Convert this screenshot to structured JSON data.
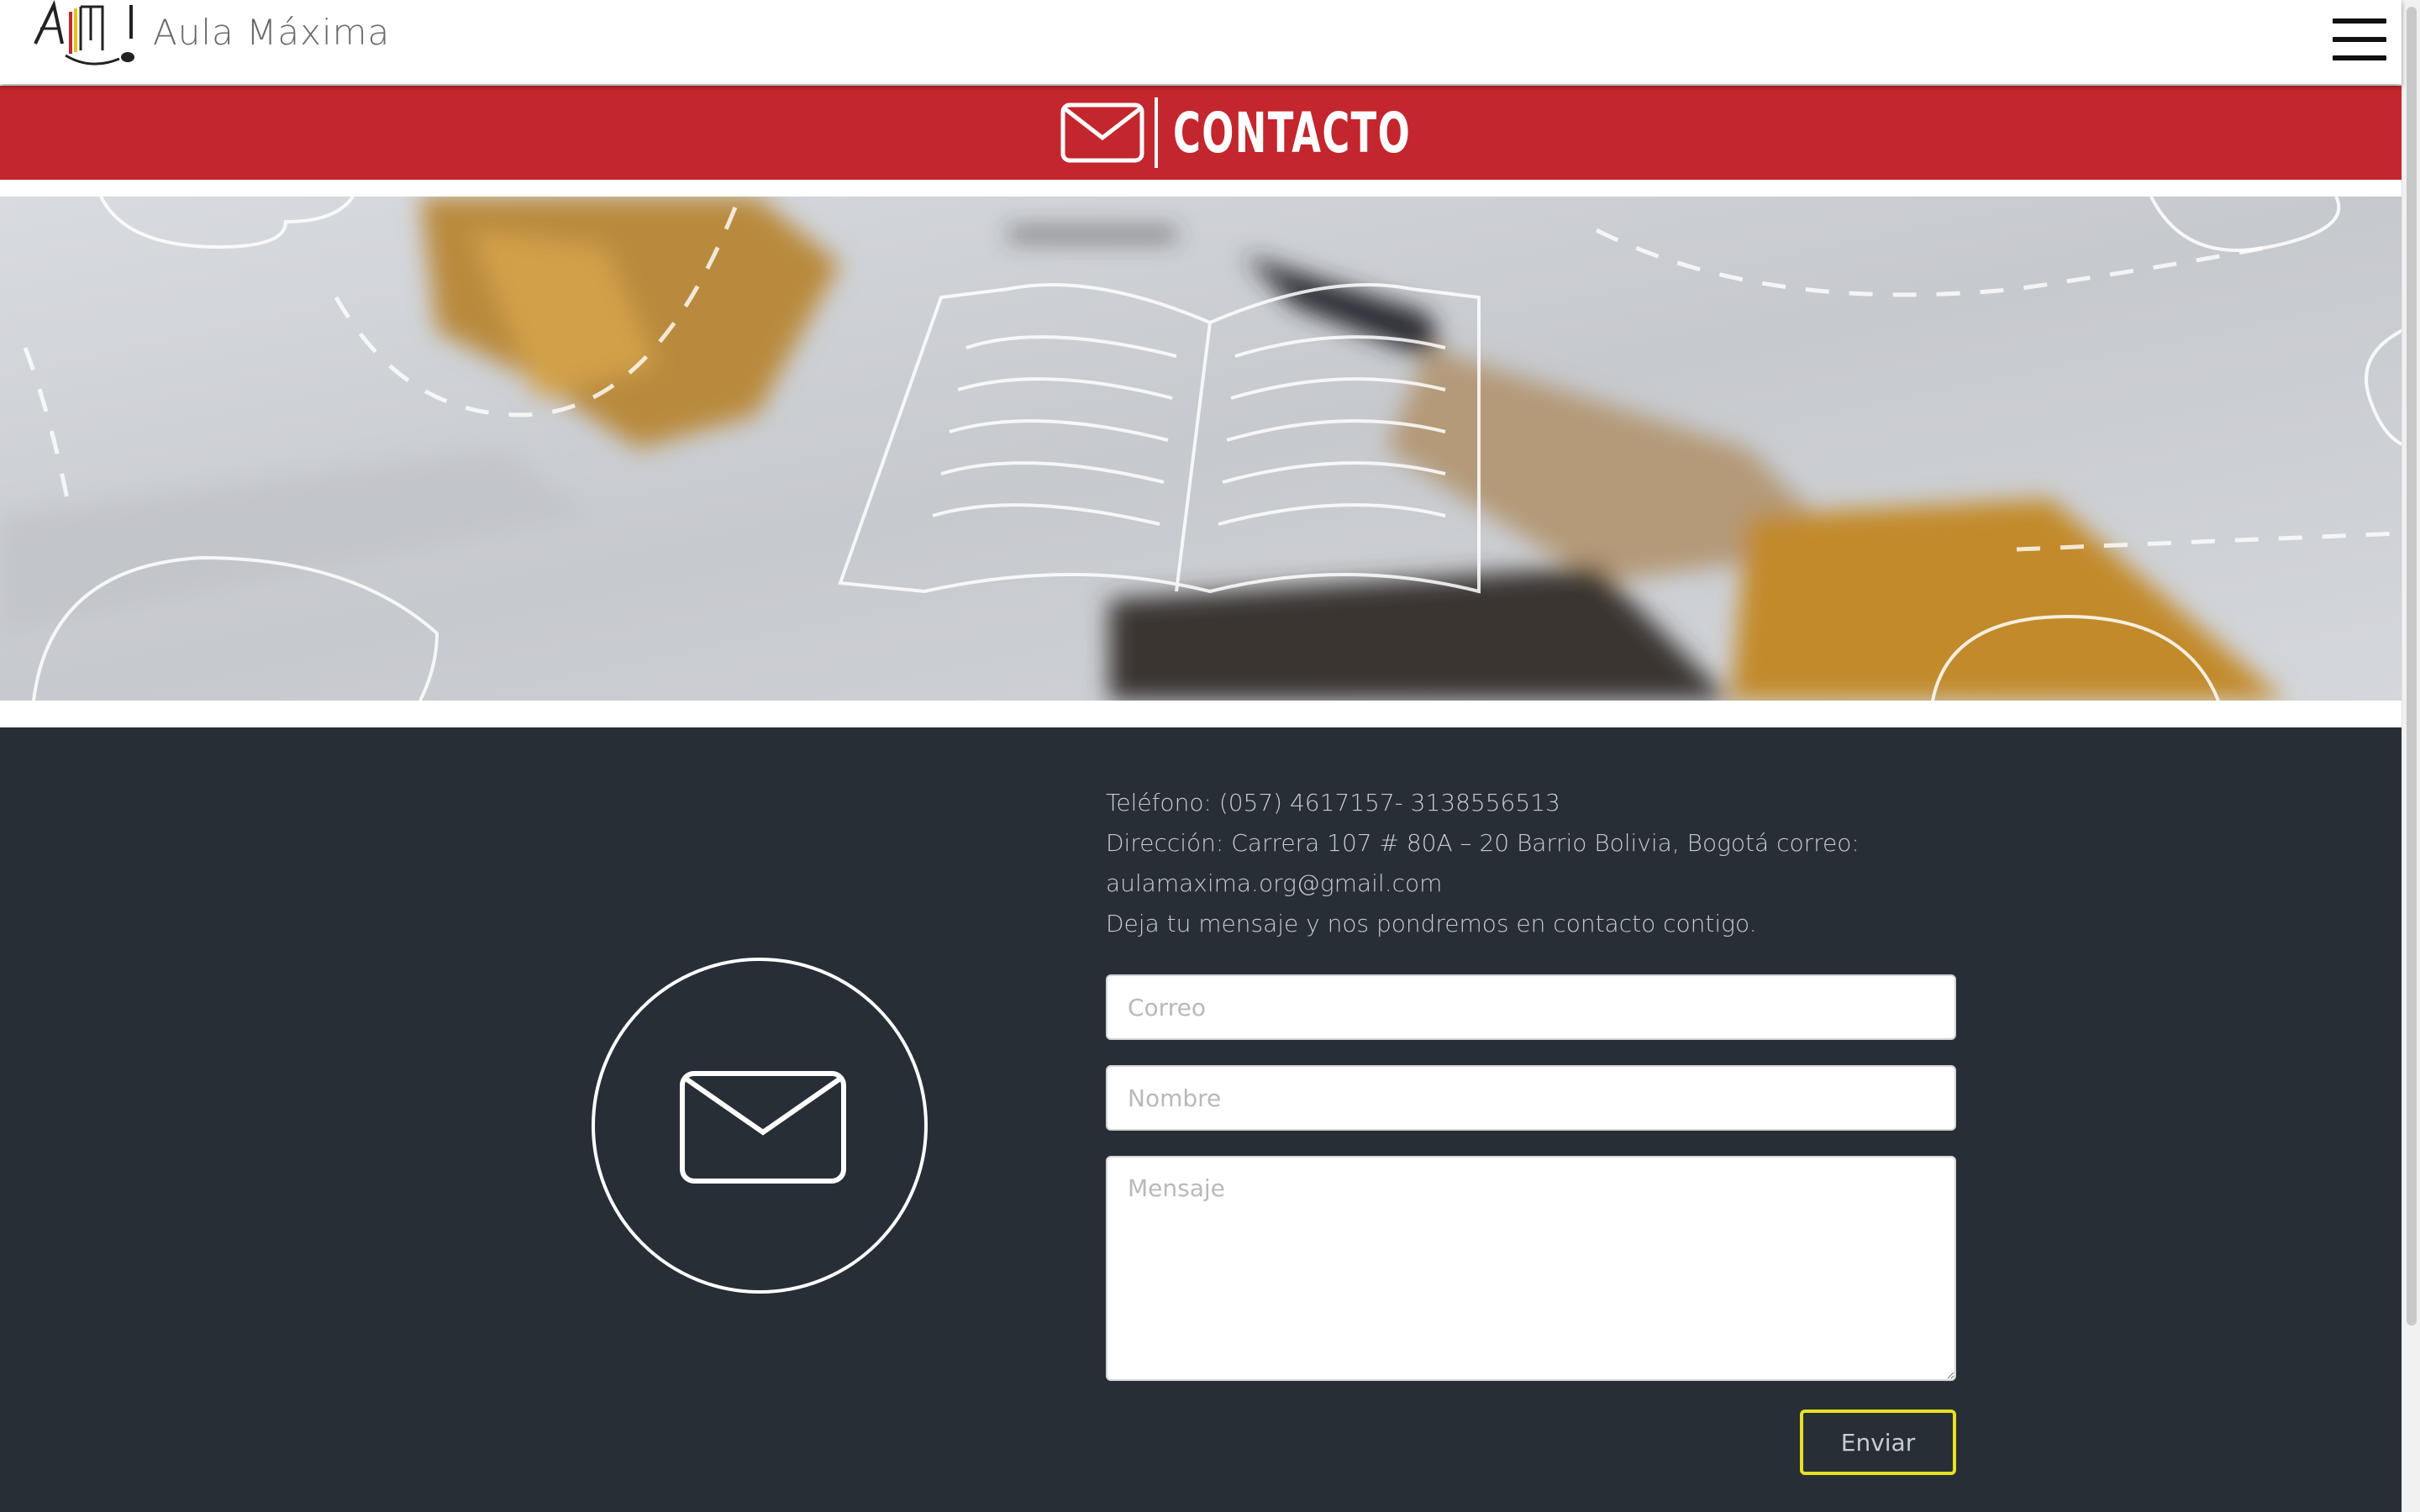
{
  "header": {
    "brand_name": "Aula Máxima",
    "logo_icon": "aula-maxima-logo",
    "menu_icon": "hamburger-menu-icon"
  },
  "banner": {
    "title": "CONTACTO",
    "icon": "envelope-icon",
    "background_color": "#c4262e"
  },
  "hero": {
    "image": "open-book-and-pencil-photo"
  },
  "contact": {
    "background_color": "#282e36",
    "phone": "Teléfono: (057) 4617157- 3138556513",
    "address": "Dirección: Carrera 107 # 80A – 20 Barrio Bolivia, Bogotá correo:",
    "email": "aulamaxima.org@gmail.com",
    "invite": "Deja tu mensaje y nos pondremos en contacto contigo.",
    "form": {
      "email_placeholder": "Correo",
      "name_placeholder": "Nombre",
      "message_placeholder": "Mensaje",
      "submit_label": "Enviar"
    },
    "accent_color": "#e6e021"
  }
}
